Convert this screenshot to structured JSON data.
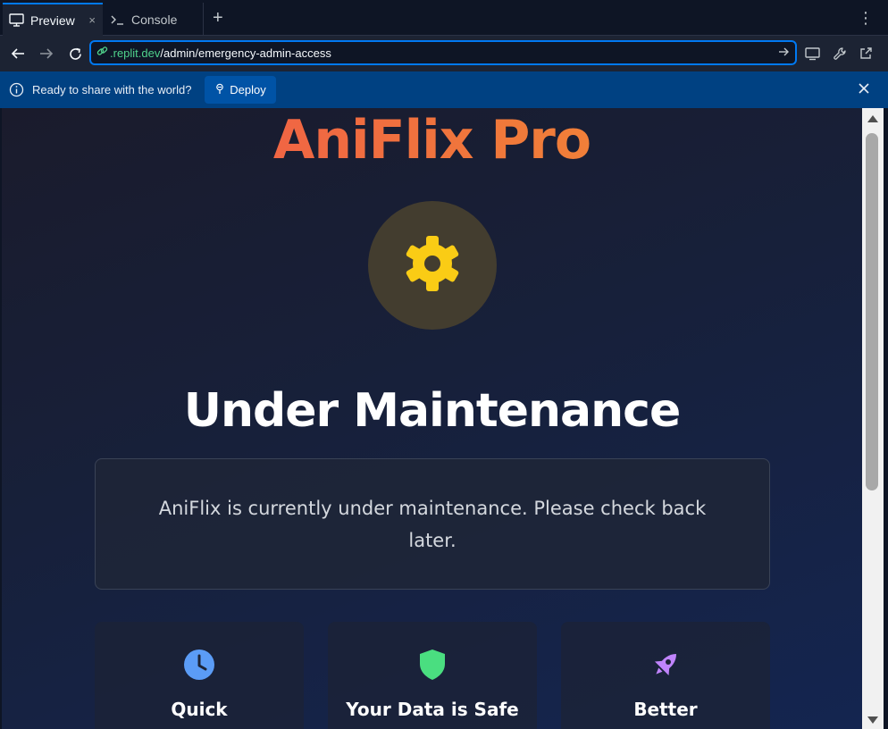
{
  "tabs": {
    "preview_label": "Preview",
    "console_label": "Console",
    "new_tab_symbol": "+",
    "close_symbol": "×",
    "menu_symbol": "⋮"
  },
  "address": {
    "url_domain": ".replit.dev",
    "url_path": "/admin/emergency-admin-access"
  },
  "banner": {
    "message": "Ready to share with the world?",
    "deploy_label": "Deploy"
  },
  "page": {
    "brand": "AniFlix Pro",
    "headline": "Under Maintenance",
    "notice": "AniFlix is currently under maintenance. Please check back later.",
    "features": [
      {
        "title": "Quick",
        "icon": "clock-icon",
        "color": "#5b9cf6"
      },
      {
        "title": "Your Data is Safe",
        "icon": "shield-icon",
        "color": "#4ade80"
      },
      {
        "title": "Better",
        "icon": "rocket-icon",
        "color": "#c084fc"
      }
    ]
  },
  "colors": {
    "accent": "#0079f2",
    "banner_bg": "#004182",
    "brand_start": "#ef4e4e",
    "brand_end": "#f39234",
    "gear": "#facc15"
  }
}
